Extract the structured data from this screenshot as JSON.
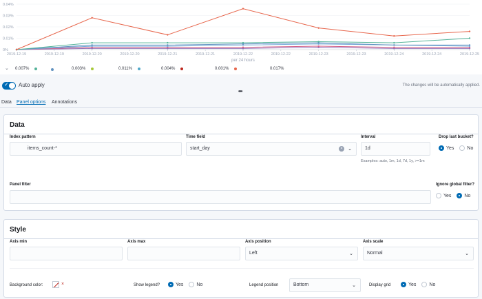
{
  "chart_data": {
    "type": "line",
    "title": "",
    "xlabel": "per 24 hours",
    "ylabel": "",
    "ylim": [
      0,
      0.04
    ],
    "y_ticks": [
      "0%",
      "0.01%",
      "0.02%",
      "0.03%",
      "0.04%"
    ],
    "x_ticks": [
      "2019-12-19",
      "2019-12-19",
      "2019-12-20",
      "2019-12-20",
      "2019-12-21",
      "2019-12-21",
      "2019-12-22",
      "2019-12-22",
      "2019-12-23",
      "2019-12-23",
      "2019-12-24",
      "2019-12-24",
      "2019-12-25"
    ],
    "x": [
      "2019-12-19",
      "2019-12-20",
      "2019-12-21",
      "2019-12-22",
      "2019-12-23",
      "2019-12-24",
      "2019-12-25"
    ],
    "series": [
      {
        "color": "#e7664c",
        "values": [
          0.0,
          0.028,
          0.013,
          0.036,
          0.019,
          0.012,
          0.016
        ]
      },
      {
        "color": "#54b399",
        "values": [
          0.0,
          0.006,
          0.006,
          0.006,
          0.007,
          0.006,
          0.01
        ]
      },
      {
        "color": "#6092c0",
        "values": [
          0.0,
          0.004,
          0.004,
          0.005,
          0.006,
          0.004,
          0.004
        ]
      },
      {
        "color": "#79aad9",
        "values": [
          0.0,
          0.003,
          0.003,
          0.004,
          0.005,
          0.004,
          0.003
        ]
      },
      {
        "color": "#d36086",
        "values": [
          0.0,
          0.002,
          0.002,
          0.002,
          0.003,
          0.002,
          0.002
        ]
      },
      {
        "color": "#9170b8",
        "values": [
          0.0,
          0.001,
          0.001,
          0.001,
          0.002,
          0.001,
          0.001
        ]
      }
    ]
  },
  "legend": {
    "toggle_icon": "chevron-down",
    "items": [
      {
        "value": "0.007%",
        "color": "#54b399"
      },
      {
        "value": "0.003%",
        "color": "#6092c0"
      },
      {
        "value": "0.011%",
        "color": "#a6c838"
      },
      {
        "value": "0.004%",
        "color": "#4fa8c9"
      },
      {
        "value": "0.001%",
        "color": "#bd271e"
      },
      {
        "value": "0.017%",
        "color": "#e7664c"
      }
    ]
  },
  "apply": {
    "label": "Auto apply",
    "note": "The changes will be automatically applied."
  },
  "tabs": [
    {
      "label": "Data",
      "active": false
    },
    {
      "label": "Panel options",
      "active": true
    },
    {
      "label": "Annotations",
      "active": false
    }
  ],
  "data_panel": {
    "title": "Data",
    "index_pattern_label": "Index pattern",
    "index_pattern_value": "items_count-*",
    "time_field_label": "Time field",
    "time_field_value": "start_day",
    "interval_label": "Interval",
    "interval_value": "1d",
    "interval_help": "Examples: auto, 1m, 1d, 7d, 1y, >=1m",
    "drop_last_label": "Drop last bucket?",
    "panel_filter_label": "Panel filter",
    "panel_filter_value": "",
    "ignore_global_label": "Ignore global filter?",
    "yes": "Yes",
    "no": "No"
  },
  "style_panel": {
    "title": "Style",
    "axis_min_label": "Axis min",
    "axis_max_label": "Axis max",
    "axis_position_label": "Axis position",
    "axis_position_value": "Left",
    "axis_scale_label": "Axis scale",
    "axis_scale_value": "Normal",
    "bg_color_label": "Background color:",
    "show_legend_label": "Show legend?",
    "legend_position_label": "Legend position",
    "legend_position_value": "Bottom",
    "display_grid_label": "Display grid",
    "yes": "Yes",
    "no": "No"
  },
  "colors": {
    "accent": "#006bb4",
    "danger": "#bd271e"
  }
}
